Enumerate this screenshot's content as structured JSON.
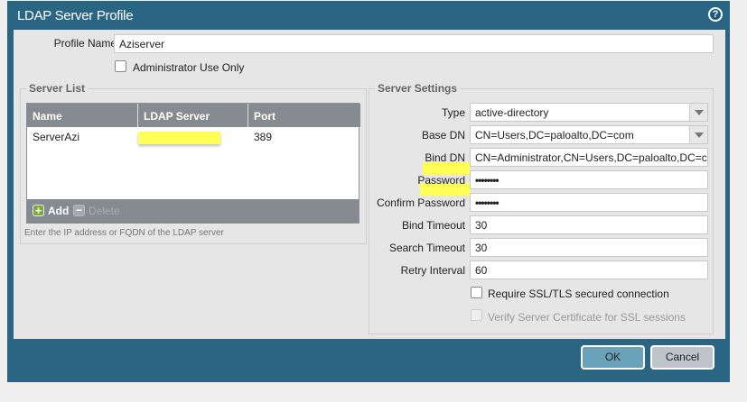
{
  "dialog": {
    "title": "LDAP Server Profile",
    "help_icon": "?"
  },
  "profile": {
    "name_label": "Profile Name",
    "name_value": "Aziserver",
    "admin_only_label": "Administrator Use Only",
    "admin_only_checked": false
  },
  "server_list": {
    "legend": "Server List",
    "columns": [
      "Name",
      "LDAP Server",
      "Port"
    ],
    "rows": [
      {
        "name": "ServerAzi",
        "ldap_server": "",
        "port": "389"
      }
    ],
    "add_label": "Add",
    "delete_label": "Delete",
    "hint": "Enter the IP address or FQDN of the LDAP server"
  },
  "settings": {
    "legend": "Server Settings",
    "type_label": "Type",
    "type_value": "active-directory",
    "base_dn_label": "Base DN",
    "base_dn_value": "CN=Users,DC=paloalto,DC=com",
    "bind_dn_label": "Bind DN",
    "bind_dn_value": "CN=Administrator,CN=Users,DC=paloalto,DC=com",
    "password_label": "Password",
    "password_value": "••••••••",
    "confirm_label": "Confirm Password",
    "confirm_value": "••••••••",
    "bind_timeout_label": "Bind Timeout",
    "bind_timeout_value": "30",
    "search_timeout_label": "Search Timeout",
    "search_timeout_value": "30",
    "retry_label": "Retry Interval",
    "retry_value": "60",
    "ssl_label": "Require SSL/TLS secured connection",
    "ssl_checked": false,
    "verify_label": "Verify Server Certificate for SSL sessions",
    "verify_checked": false
  },
  "footer": {
    "ok": "OK",
    "cancel": "Cancel"
  }
}
